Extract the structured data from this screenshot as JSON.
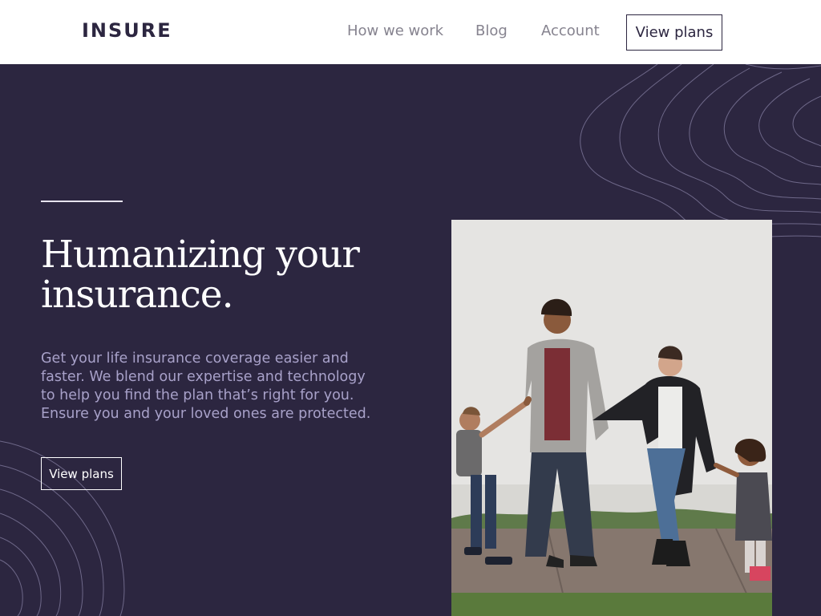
{
  "header": {
    "logo": "INSURE",
    "nav": [
      {
        "label": "How we work"
      },
      {
        "label": "Blog"
      },
      {
        "label": "Account"
      }
    ],
    "cta_label": "View plans"
  },
  "hero": {
    "title": "Humanizing your insurance.",
    "body": "Get your life insurance coverage easier and faster. We blend our expertise and technology to help you find the plan that’s right for you. Ensure you and your loved ones are protected.",
    "cta_label": "View plans",
    "image": "family-walking-photo"
  },
  "colors": {
    "dark_violet": "#2c2640",
    "white": "#ffffff",
    "grayish_violet": "#86838f",
    "light_violet": "#a8a1c9"
  }
}
